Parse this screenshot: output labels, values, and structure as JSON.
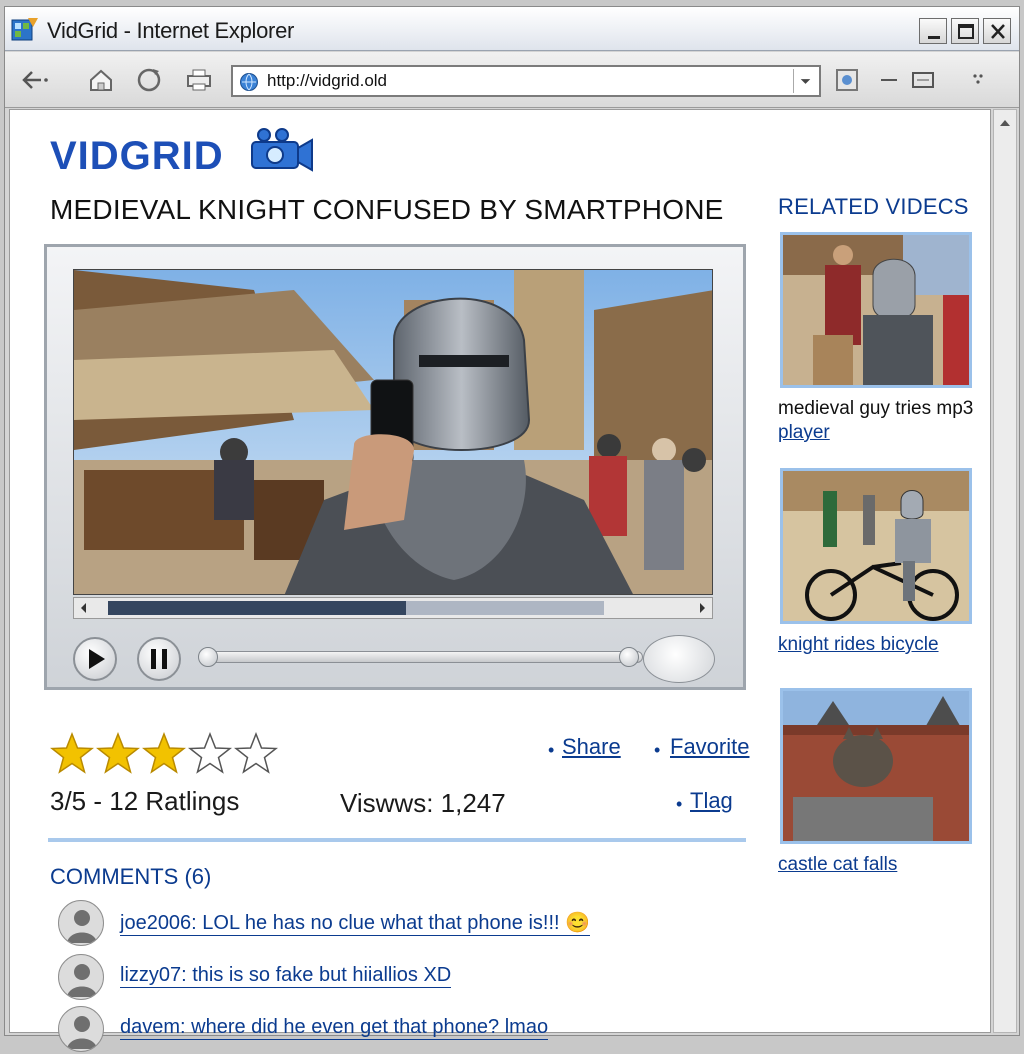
{
  "window": {
    "title": "VidGrid - Internet Explorer",
    "url": "http://vidgrid.old"
  },
  "site": {
    "logo": "VIDGRID"
  },
  "video": {
    "title": "MEDIEVAL KNIGHT CONFUSED BY SMARTPHONE",
    "playback_progress": 0.97,
    "buffer_progress": 0.6
  },
  "rating": {
    "stars_filled": 3,
    "stars_total": 5,
    "summary": "3/5 - 12 Ratlings",
    "views": "Viswws: 1,247"
  },
  "actions": {
    "share": "Share",
    "favorite": "Favorite",
    "flag": "Tlag"
  },
  "comments": {
    "title": "COMMENTS (6)",
    "items": [
      {
        "text": "joe2006: LOL he has no clue what that phone is!!! 😊"
      },
      {
        "text": "lizzy07: this is so fake but hiiallios XD"
      },
      {
        "text": "davem: where did he even get that phone? lmao"
      }
    ]
  },
  "related": {
    "title": "RELATED VIDECS",
    "items": [
      {
        "label": "medieval guy tries mp3",
        "label2": "player"
      },
      {
        "label": "knight rides bicycle"
      },
      {
        "label": "castle cat falls"
      }
    ]
  },
  "colors": {
    "brand": "#1d4fb7",
    "link": "#0b3b8f",
    "star": "#f2c200",
    "divider": "#a9c9ec"
  }
}
